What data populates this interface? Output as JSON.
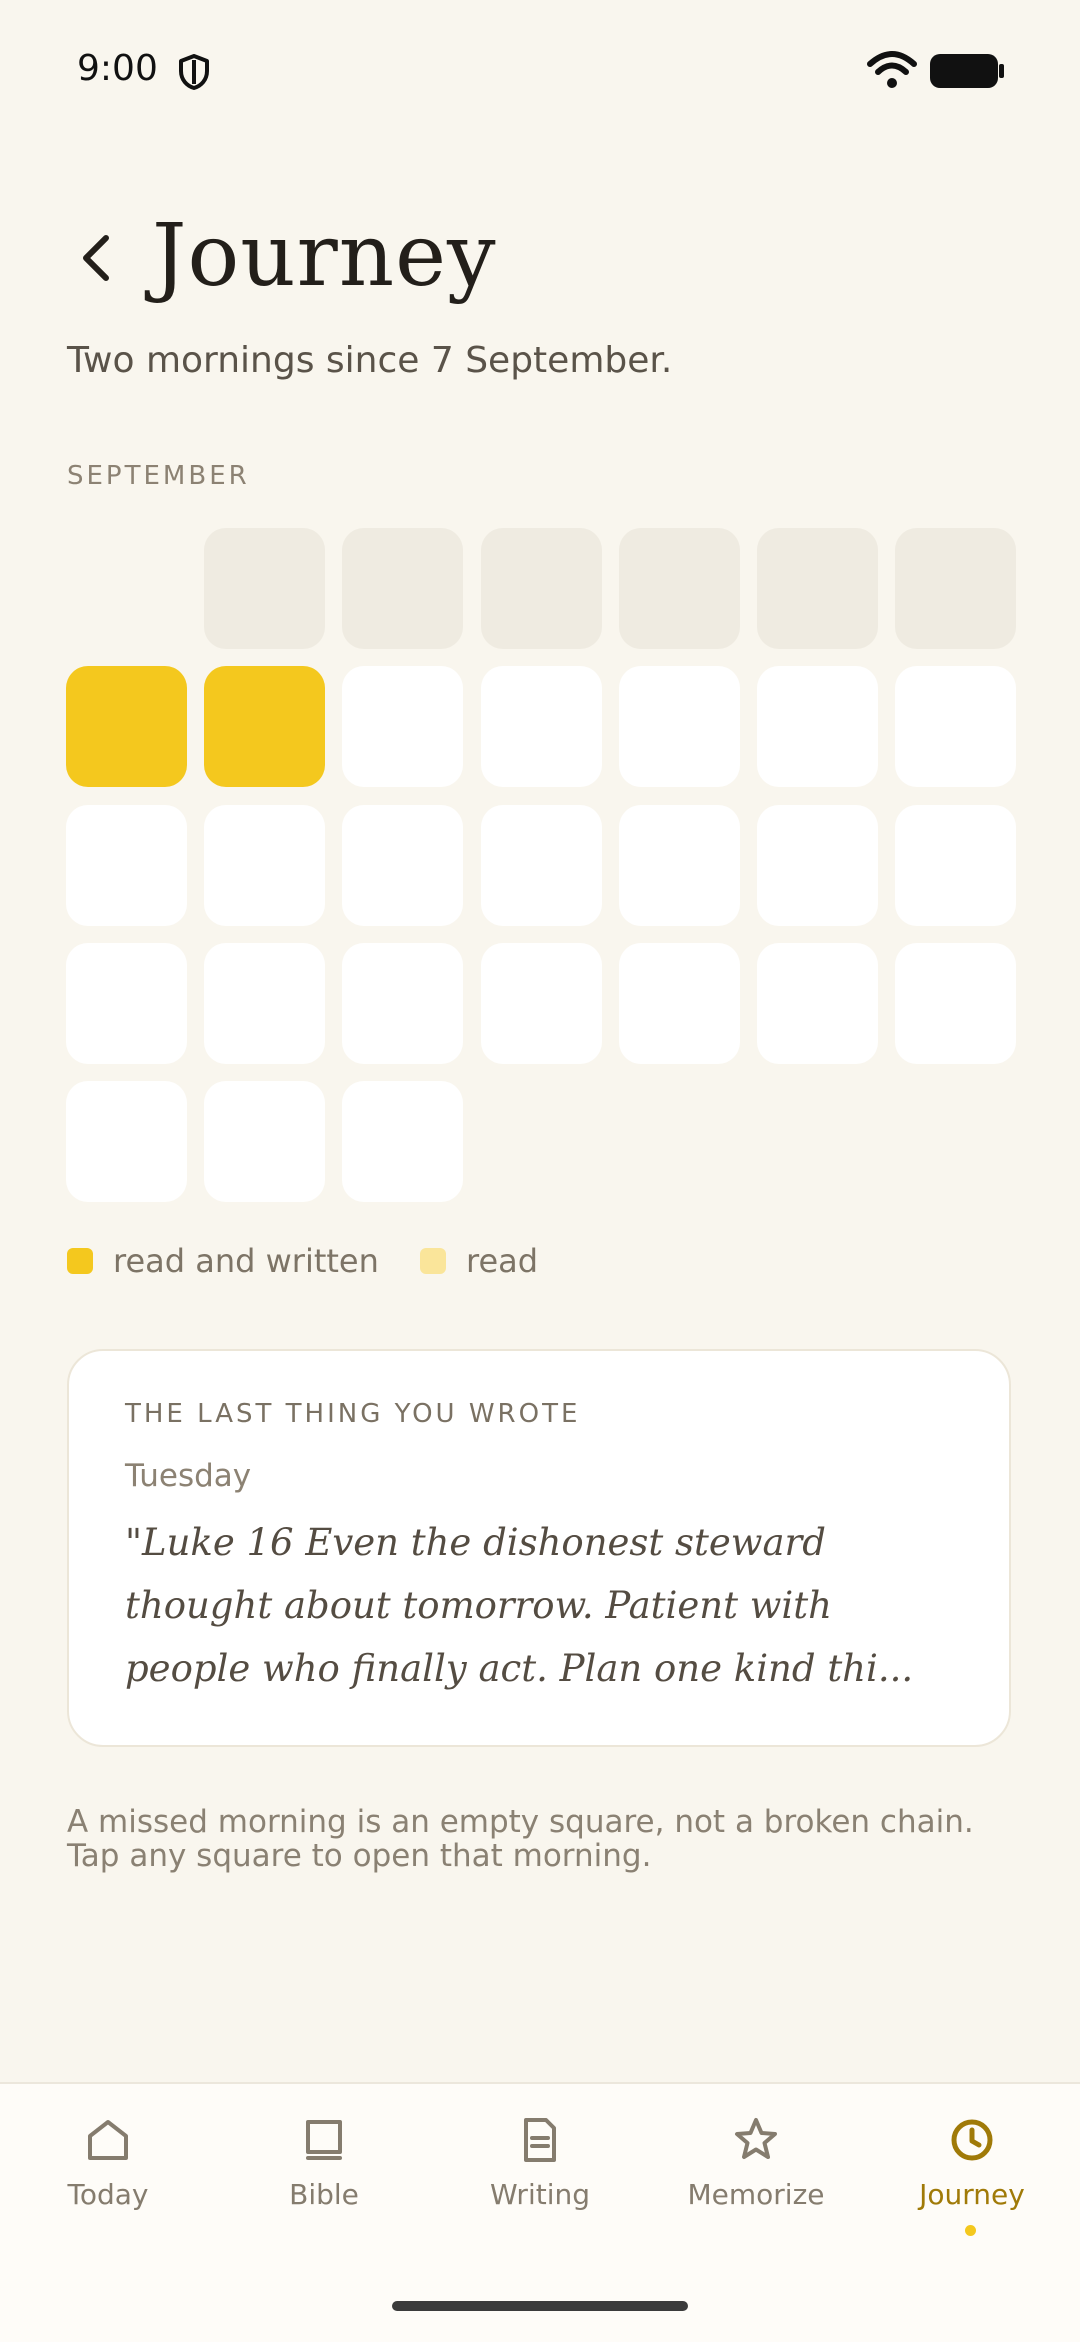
{
  "status": {
    "time": "9:00"
  },
  "header": {
    "title": "Journey",
    "subtitle": "Two mornings since 7 September."
  },
  "calendar": {
    "month": "SEPTEMBER",
    "leading_empty": 1,
    "days": [
      "padded",
      "padded",
      "padded",
      "padded",
      "padded",
      "padded",
      "read and written",
      "read and written",
      "empty",
      "empty",
      "empty",
      "empty",
      "empty",
      "empty",
      "empty",
      "empty",
      "empty",
      "empty",
      "empty",
      "empty",
      "empty",
      "empty",
      "empty",
      "empty",
      "empty",
      "empty",
      "empty",
      "empty",
      "empty",
      "empty"
    ],
    "colors": {
      "read_and_written": "#f4c81e",
      "read": "#fae59a",
      "empty": "#ffffff",
      "padded": "#efebe1"
    }
  },
  "legend": [
    {
      "label": "read and written",
      "color": "#f4c81e"
    },
    {
      "label": "read",
      "color": "#fae59a"
    }
  ],
  "last_entry": {
    "heading": "THE LAST THING YOU WROTE",
    "day": "Tuesday",
    "text": "\"Luke 16 Even the dishonest steward thought about tomorrow. Patient with people who finally act. Plan one kind thi..."
  },
  "footnote": {
    "line1": "A missed morning is an empty square, not a broken chain.",
    "line2": "Tap any square to open that morning."
  },
  "nav": [
    {
      "label": "Today",
      "icon": "home-icon"
    },
    {
      "label": "Bible",
      "icon": "book-icon"
    },
    {
      "label": "Writing",
      "icon": "document-icon"
    },
    {
      "label": "Memorize",
      "icon": "star-icon"
    },
    {
      "label": "Journey",
      "icon": "clock-icon",
      "active": true
    }
  ],
  "accent": "#f4c81e"
}
